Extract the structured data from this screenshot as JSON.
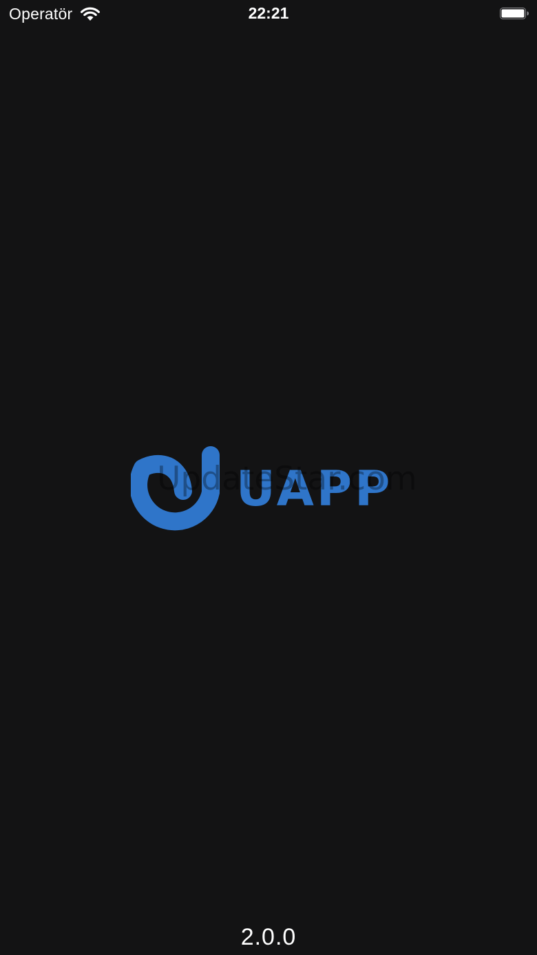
{
  "status_bar": {
    "carrier": "Operatör",
    "time": "22:21",
    "wifi_icon": "wifi-icon",
    "battery_icon": "battery-icon"
  },
  "splash": {
    "logo_icon": "uapp-logo-icon",
    "logo_text": "UAPP",
    "brand_color": "#2f75c9",
    "background_color": "#131314",
    "watermark": "UpdateStar.com",
    "version": "2.0.0"
  }
}
